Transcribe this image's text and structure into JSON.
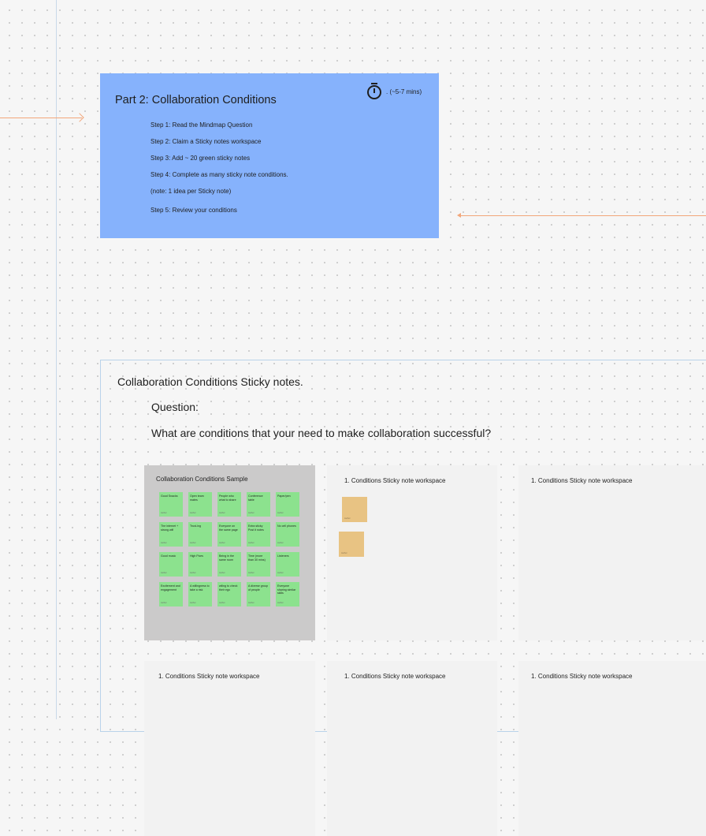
{
  "instructions": {
    "title": "Part 2: Collaboration Conditions",
    "timer": ". (~5-7 mins)",
    "steps": [
      "Step 1:  Read the Mindmap Question",
      "Step 2: Claim a Sticky notes workspace",
      "Step 3: Add ~ 20 green sticky notes",
      "Step 4: Complete as many sticky note conditions.",
      "(note: 1 idea per Sticky note)",
      "Step 5: Review your conditions"
    ]
  },
  "board": {
    "title": "Collaboration Conditions Sticky notes.",
    "question_label": "Question:",
    "question_text": "What are conditions that your need to make collaboration successful?"
  },
  "sample": {
    "title": "Collaboration Conditions Sample",
    "notes": [
      {
        "text": "Good Snacks",
        "author": "Author"
      },
      {
        "text": "Open team mates",
        "author": "Author"
      },
      {
        "text": "People who what to share",
        "author": "Author"
      },
      {
        "text": "Conference table",
        "author": "Author"
      },
      {
        "text": "Paper/pen",
        "author": "Author"
      },
      {
        "text": "The internet + strong wifi",
        "author": "Author"
      },
      {
        "text": "Trust-ing",
        "author": "Author"
      },
      {
        "text": "Everyone on the same page",
        "author": "Author"
      },
      {
        "text": "Extra sticky Post it notes",
        "author": "Author"
      },
      {
        "text": "No cell phones",
        "author": "Author"
      },
      {
        "text": "Good music",
        "author": "Author"
      },
      {
        "text": "High Fives",
        "author": "Author"
      },
      {
        "text": "Being in the same room",
        "author": "Author"
      },
      {
        "text": "Time (more than 30 mins)",
        "author": "Author"
      },
      {
        "text": "Listeners",
        "author": "Author"
      },
      {
        "text": "Excitement and engagement",
        "author": "Author"
      },
      {
        "text": "A willingness to take a risk",
        "author": "Author"
      },
      {
        "text": "wiling to check their ego",
        "author": "Author"
      },
      {
        "text": "A diverse group of people",
        "author": "Author"
      },
      {
        "text": "Everyone sharing similar skills",
        "author": "Author"
      }
    ]
  },
  "workspaces": [
    {
      "title": "1. Conditions Sticky note workspace"
    },
    {
      "title": "1. Conditions Sticky note workspace"
    },
    {
      "title": "1. Conditions Sticky note workspace"
    },
    {
      "title": "1. Conditions Sticky note workspace"
    },
    {
      "title": "1. Conditions Sticky note workspace"
    }
  ],
  "orange_notes": [
    {
      "author": "Author"
    },
    {
      "author": "Author"
    }
  ],
  "colors": {
    "canvas": "#f6f6f6",
    "instructions_bg": "#86b2fc",
    "sample_bg": "#cbcaca",
    "green_note": "#8ce28e",
    "orange_note": "#e8c383",
    "workspace_bg": "#f2f2f2",
    "connector": "#f2a67a"
  }
}
